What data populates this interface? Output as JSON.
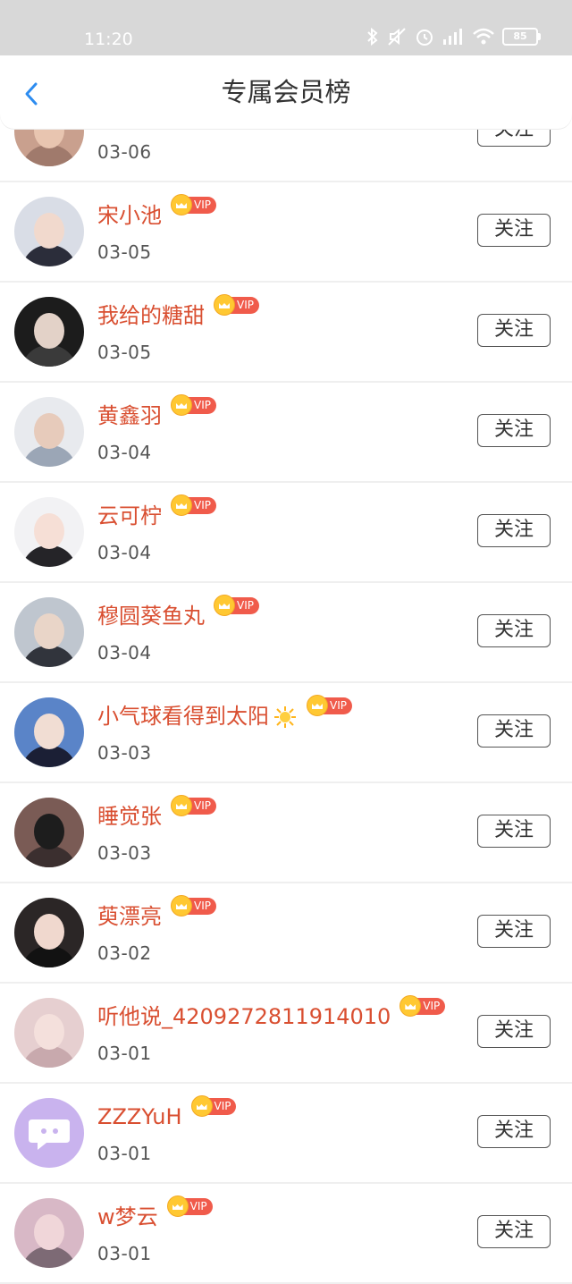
{
  "status_bar": {
    "time": "11:20",
    "battery": "85"
  },
  "header": {
    "title": "专属会员榜"
  },
  "follow_label": "关注",
  "vip_label": "VIP",
  "members": [
    {
      "name": "",
      "date": "03-06",
      "vip": false,
      "avatar_bg": "#c9a08e",
      "face": "#e8c5b0",
      "body": "#a07a6c"
    },
    {
      "name": "宋小池",
      "date": "03-05",
      "vip": true,
      "avatar_bg": "#d9dde6",
      "face": "#f1d9cd",
      "body": "#2b2d3a"
    },
    {
      "name": "我给的糖甜",
      "date": "03-05",
      "vip": true,
      "avatar_bg": "#1c1c1c",
      "face": "#e3d2c8",
      "body": "#3a3a3a"
    },
    {
      "name": "黄鑫羽",
      "date": "03-04",
      "vip": true,
      "avatar_bg": "#e8eaee",
      "face": "#e7cbbb",
      "body": "#9ba6b6"
    },
    {
      "name": "云可柠",
      "date": "03-04",
      "vip": true,
      "avatar_bg": "#f2f2f4",
      "face": "#f6dfd6",
      "body": "#252428"
    },
    {
      "name": "穆圆葵鱼丸",
      "date": "03-04",
      "vip": true,
      "avatar_bg": "#bfc6cf",
      "face": "#e9d5c8",
      "body": "#31343c"
    },
    {
      "name": "小气球看得到太阳",
      "date": "03-03",
      "vip": true,
      "sun": true,
      "avatar_bg": "#5a84c8",
      "face": "#f1ddd3",
      "body": "#1b1f35"
    },
    {
      "name": "睡觉张",
      "date": "03-03",
      "vip": true,
      "avatar_bg": "#7a5b55",
      "face": "#1d1d1d",
      "body": "#3b2f2f"
    },
    {
      "name": "萸漂亮",
      "date": "03-02",
      "vip": true,
      "avatar_bg": "#2b2626",
      "face": "#f0d8ce",
      "body": "#121212"
    },
    {
      "name": "听他说_4209272811914010",
      "date": "03-01",
      "vip": true,
      "avatar_bg": "#e6cfd0",
      "face": "#f4e0dc",
      "body": "#c8a9ad"
    },
    {
      "name": "ZZZYuH",
      "date": "03-01",
      "vip": true,
      "avatar_bg": "#c9b3ee",
      "face": "",
      "body": "",
      "icon": "chat-bubble"
    },
    {
      "name": "w梦云",
      "date": "03-01",
      "vip": true,
      "avatar_bg": "#d8b8c6",
      "face": "#f0d6d9",
      "body": "#7d6a75"
    }
  ]
}
